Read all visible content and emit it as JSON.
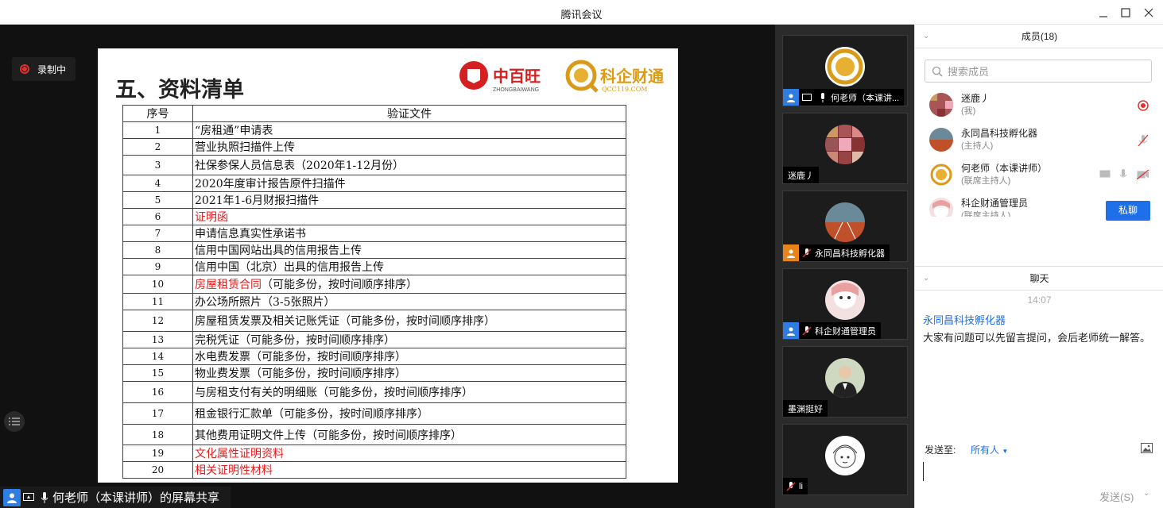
{
  "window": {
    "title": "腾讯会议"
  },
  "recording": {
    "label": "录制中"
  },
  "slide": {
    "title": "五、资料清单",
    "logo1": {
      "cn": "中百旺",
      "en": "ZHONGBAIWANG"
    },
    "logo2": {
      "cn": "科企财通",
      "en": "QCC119.COM"
    },
    "headers": [
      "序号",
      "验证文件"
    ],
    "rows": [
      {
        "n": "1",
        "text": "“房租通”申请表",
        "red": false
      },
      {
        "n": "2",
        "text": "营业执照扫描件上传",
        "red": false
      },
      {
        "n": "3",
        "text": "社保参保人员信息表（2020年1-12月份）",
        "red": false
      },
      {
        "n": "4",
        "text": "2020年度审计报告原件扫描件",
        "red": false
      },
      {
        "n": "5",
        "text": "2021年1-6月财报扫描件",
        "red": false
      },
      {
        "n": "6",
        "text": "证明函",
        "red": true
      },
      {
        "n": "7",
        "text": "申请信息真实性承诺书",
        "red": false
      },
      {
        "n": "8",
        "text": "信用中国网站出具的信用报告上传",
        "red": false
      },
      {
        "n": "9",
        "text": "信用中国（北京）出具的信用报告上传",
        "red": false
      },
      {
        "n": "10",
        "text": "房屋租赁合同",
        "red": true,
        "suffix": "（可能多份，按时间顺序排序）"
      },
      {
        "n": "11",
        "text": "办公场所照片（3-5张照片）",
        "red": false
      },
      {
        "n": "12",
        "text": "房屋租赁发票及相关记账凭证（可能多份，按时间顺序排序）",
        "red": false
      },
      {
        "n": "13",
        "text": "完税凭证（可能多份，按时间顺序排序）",
        "red": false
      },
      {
        "n": "14",
        "text": "水电费发票（可能多份，按时间顺序排序）",
        "red": false
      },
      {
        "n": "15",
        "text": "物业费发票（可能多份，按时间顺序排序）",
        "red": false
      },
      {
        "n": "16",
        "text": "与房租支付有关的明细账（可能多份，按时间顺序排序）",
        "red": false
      },
      {
        "n": "17",
        "text": "租金银行汇款单（可能多份，按时间顺序排序）",
        "red": false
      },
      {
        "n": "18",
        "text": "其他费用证明文件上传（可能多份，按时间顺序排序）",
        "red": false
      },
      {
        "n": "19",
        "text": "文化属性证明资料",
        "red": true
      },
      {
        "n": "20",
        "text": "相关证明性材料",
        "red": true
      }
    ]
  },
  "share_bar": {
    "label": "何老师（本课讲师）的屏幕共享"
  },
  "video_tiles": [
    {
      "name": "何老师（本课讲...",
      "avatar": "gold-logo"
    },
    {
      "name": "迷鹿丿",
      "avatar": "photo-collage"
    },
    {
      "name": "永同昌科技孵化器",
      "avatar": "track"
    },
    {
      "name": "科企财通管理员",
      "avatar": "doll"
    },
    {
      "name": "墨渊挺好",
      "avatar": "person"
    },
    {
      "name": "li",
      "avatar": "sketch"
    }
  ],
  "members": {
    "header": "成员(18)",
    "search_placeholder": "搜索成员",
    "list": [
      {
        "name": "迷鹿丿",
        "role": "(我)"
      },
      {
        "name": "永同昌科技孵化器",
        "role": "(主持人)"
      },
      {
        "name": "何老师（本课讲师）",
        "role": "(联席主持人)"
      },
      {
        "name": "科企财通管理员",
        "role": "(联席主持人)"
      }
    ],
    "private_chat": "私聊"
  },
  "chat": {
    "header": "聊天",
    "time": "14:07",
    "sender": "永同昌科技孵化器",
    "message": "大家有问题可以先留言提问，会后老师统一解答。",
    "send_to_label": "发送至:",
    "send_to_value": "所有人",
    "send_button": "发送(S)"
  },
  "colors": {
    "accent": "#1e6fe8",
    "danger": "#e02020",
    "stage": "#111111"
  }
}
